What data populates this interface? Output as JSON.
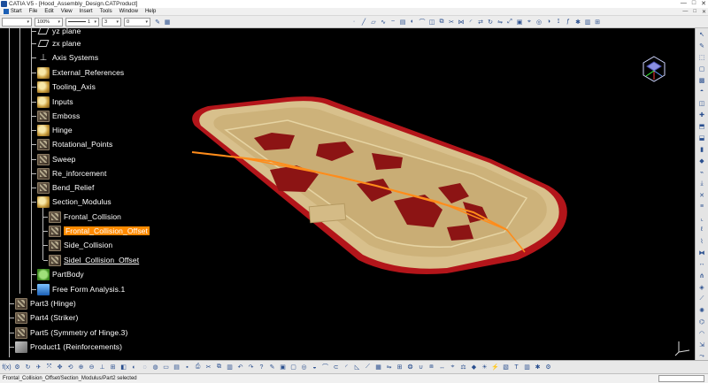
{
  "window": {
    "title": "CATIA V5 - [Hood_Assembly_Design.CATProduct]",
    "controls": [
      "—",
      "□",
      "✕"
    ]
  },
  "menu": {
    "items": [
      "Start",
      "File",
      "Edit",
      "View",
      "Insert",
      "Tools",
      "Window",
      "Help"
    ],
    "mdi_controls": [
      "—",
      "□",
      "✕"
    ]
  },
  "toolbar": {
    "zoom_value": "100%",
    "line_type_value": "1",
    "thickness_value": "3",
    "layer_value": "0"
  },
  "tree": {
    "partial_top_label": "yz plane",
    "nodes": [
      {
        "label": "zx plane",
        "icon": "plane-icon"
      },
      {
        "label": "Axis Systems",
        "icon": "axis-system-icon"
      },
      {
        "label": "External_References",
        "icon": "geometrical-set-icon"
      },
      {
        "label": "Tooling_Axis",
        "icon": "geometrical-set-icon"
      },
      {
        "label": "Inputs",
        "icon": "geometrical-set-icon"
      },
      {
        "label": "Emboss",
        "icon": "body-icon"
      },
      {
        "label": "Hinge",
        "icon": "geometrical-set-icon"
      },
      {
        "label": "Rotational_Points",
        "icon": "body-icon"
      },
      {
        "label": "Sweep",
        "icon": "body-icon"
      },
      {
        "label": "Re_inforcement",
        "icon": "body-icon"
      },
      {
        "label": "Bend_Relief",
        "icon": "body-icon"
      },
      {
        "label": "Section_Modulus",
        "icon": "geometrical-set-icon"
      },
      {
        "label": "Frontal_Collision",
        "icon": "body-icon"
      },
      {
        "label": "Frontal_Collision_Offset",
        "icon": "body-icon"
      },
      {
        "label": "Side_Collision",
        "icon": "body-icon"
      },
      {
        "label": "Sidel_Collision_Offset",
        "icon": "body-icon"
      },
      {
        "label": "PartBody",
        "icon": "partbody-icon"
      },
      {
        "label": "Free Form Analysis.1",
        "icon": "analysis-icon"
      },
      {
        "label": "Part3 (Hinge)",
        "icon": "part-icon"
      },
      {
        "label": "Part4 (Striker)",
        "icon": "part-icon"
      },
      {
        "label": "Part5 (Symmetry of Hinge.3)",
        "icon": "part-icon"
      },
      {
        "label": "Product1 (Reinforcements)",
        "icon": "product-icon"
      }
    ]
  },
  "colors": {
    "viewport_bg": "#000000",
    "part_surface": "#d8c08c",
    "part_edge": "#c8181c",
    "section_curve": "#ff8c1a",
    "selection_highlight": "#ff8a00"
  },
  "status": {
    "text": "Frontal_Collision_Offset/Section_Modulus/Part2 selected"
  }
}
